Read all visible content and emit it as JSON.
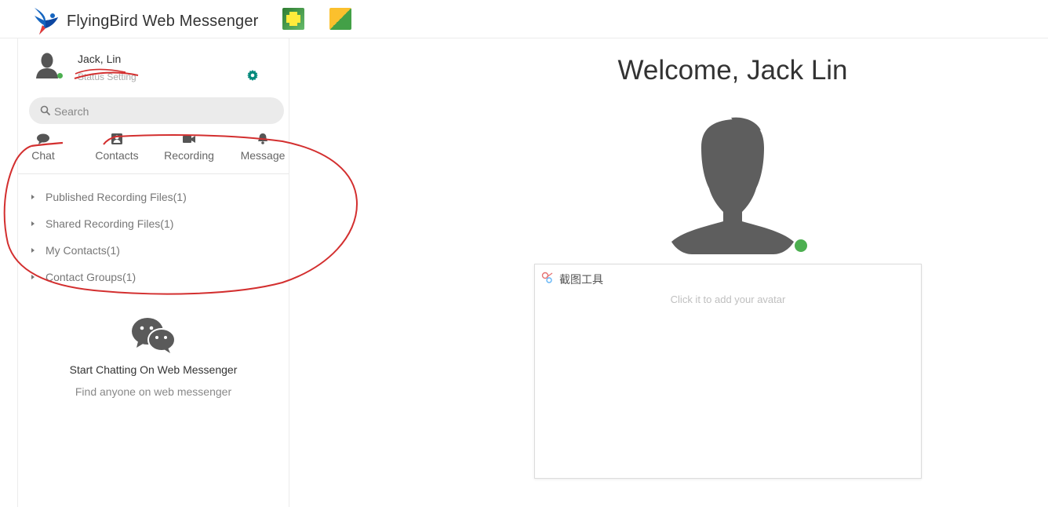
{
  "header": {
    "app_title": "FlyingBird Web Messenger",
    "logo_icon": "bird-logo",
    "app_icons": [
      "green-plus-app-icon",
      "multi-color-app-icon"
    ]
  },
  "profile": {
    "name": "Jack, Lin",
    "status": "Status Setting",
    "status_color": "#4caf50",
    "settings_icon": "gear-icon",
    "settings_color": "#00897b"
  },
  "search": {
    "placeholder": "Search"
  },
  "tabs": [
    {
      "label": "Chat",
      "icon": "chat-bubble-icon"
    },
    {
      "label": "Contacts",
      "icon": "contact-card-icon"
    },
    {
      "label": "Recording",
      "icon": "video-camera-icon"
    },
    {
      "label": "Message",
      "icon": "bell-icon"
    }
  ],
  "tree": [
    {
      "label": "Published Recording Files(1)"
    },
    {
      "label": "Shared Recording Files(1)"
    },
    {
      "label": "My Contacts(1)"
    },
    {
      "label": "Contact Groups(1)"
    }
  ],
  "empty_state": {
    "icon": "wechat-chat-icon",
    "title": "Start Chatting On Web Messenger",
    "subtitle": "Find anyone on web messenger"
  },
  "main": {
    "welcome": "Welcome, Jack Lin",
    "avatar_box": {
      "tool_label": "截图工具",
      "hint": "Click it to add your avatar"
    }
  },
  "annotation_color": "#d32f2f"
}
